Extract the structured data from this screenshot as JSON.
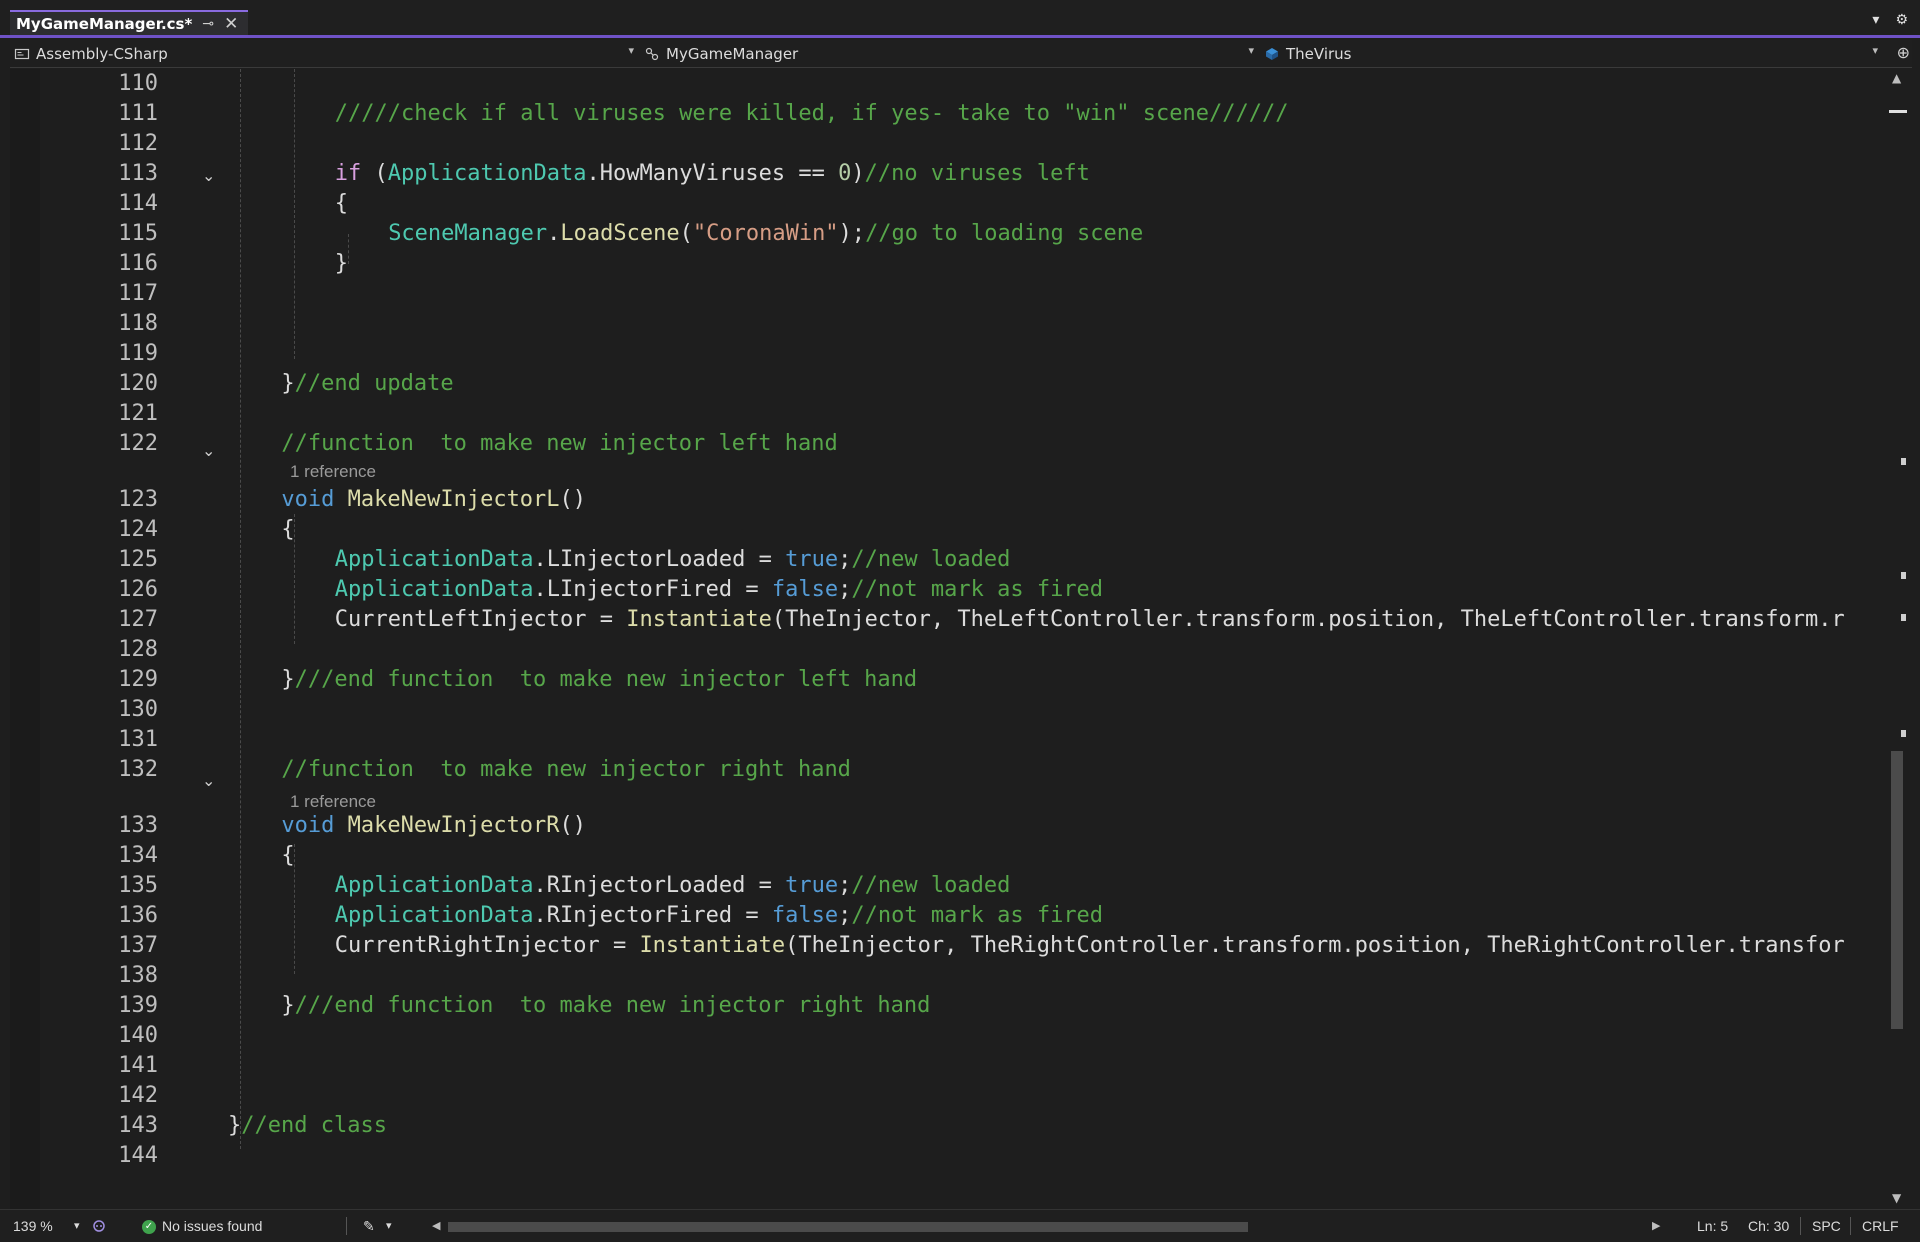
{
  "tab": {
    "title": "MyGameManager.cs*",
    "pin_icon": "pin-icon",
    "close_icon": "close-icon"
  },
  "tab_right": {
    "dropdown_icon": "chevron-down-icon",
    "settings_icon": "gear-icon"
  },
  "navbar": {
    "project": "Assembly-CSharp",
    "type": "MyGameManager",
    "member": "TheVirus"
  },
  "editor": {
    "line_numbers": [
      "110",
      "111",
      "112",
      "113",
      "114",
      "115",
      "116",
      "117",
      "118",
      "119",
      "120",
      "121",
      "122",
      "123",
      "124",
      "125",
      "126",
      "127",
      "128",
      "129",
      "130",
      "131",
      "132",
      "133",
      "134",
      "135",
      "136",
      "137",
      "138",
      "139",
      "140",
      "141",
      "142",
      "143",
      "144"
    ],
    "codelens": [
      "1 reference",
      "1 reference"
    ],
    "lines": [
      [],
      [
        [
          "cm",
          "/////check if all viruses were killed, if yes- take to \"win\" scene//////"
        ]
      ],
      [],
      [
        [
          "ctl",
          "if"
        ],
        [
          "txt",
          " ("
        ],
        [
          "cls",
          "ApplicationData"
        ],
        [
          "txt",
          ".HowManyViruses == "
        ],
        [
          "num",
          "0"
        ],
        [
          "txt",
          ")"
        ],
        [
          "cm",
          "//no viruses left"
        ]
      ],
      [
        [
          "txt",
          "{"
        ]
      ],
      [
        [
          "cls",
          "SceneManager"
        ],
        [
          "txt",
          "."
        ],
        [
          "mth",
          "LoadScene"
        ],
        [
          "txt",
          "("
        ],
        [
          "str",
          "\"CoronaWin\""
        ],
        [
          "txt",
          ");"
        ],
        [
          "cm",
          "//go to loading scene"
        ]
      ],
      [
        [
          "txt",
          "}"
        ]
      ],
      [],
      [],
      [],
      [
        [
          "txt",
          "}"
        ],
        [
          "cm",
          "//end update"
        ]
      ],
      [],
      [
        [
          "cm",
          "//function  to make new injector left hand"
        ]
      ],
      [
        [
          "kw",
          "void"
        ],
        [
          "txt",
          " "
        ],
        [
          "mth",
          "MakeNewInjectorL"
        ],
        [
          "txt",
          "()"
        ]
      ],
      [
        [
          "txt",
          "{"
        ]
      ],
      [
        [
          "cls",
          "ApplicationData"
        ],
        [
          "txt",
          ".LInjectorLoaded = "
        ],
        [
          "kw",
          "true"
        ],
        [
          "txt",
          ";"
        ],
        [
          "cm",
          "//new loaded"
        ]
      ],
      [
        [
          "cls",
          "ApplicationData"
        ],
        [
          "txt",
          ".LInjectorFired = "
        ],
        [
          "kw",
          "false"
        ],
        [
          "txt",
          ";"
        ],
        [
          "cm",
          "//not mark as fired"
        ]
      ],
      [
        [
          "txt",
          "CurrentLeftInjector = "
        ],
        [
          "mth",
          "Instantiate"
        ],
        [
          "txt",
          "(TheInjector, TheLeftController.transform.position, TheLeftController.transform.r"
        ]
      ],
      [],
      [
        [
          "txt",
          "}"
        ],
        [
          "cm",
          "///end function  to make new injector left hand"
        ]
      ],
      [],
      [],
      [
        [
          "cm",
          "//function  to make new injector right hand"
        ]
      ],
      [
        [
          "kw",
          "void"
        ],
        [
          "txt",
          " "
        ],
        [
          "mth",
          "MakeNewInjectorR"
        ],
        [
          "txt",
          "()"
        ]
      ],
      [
        [
          "txt",
          "{"
        ]
      ],
      [
        [
          "cls",
          "ApplicationData"
        ],
        [
          "txt",
          ".RInjectorLoaded = "
        ],
        [
          "kw",
          "true"
        ],
        [
          "txt",
          ";"
        ],
        [
          "cm",
          "//new loaded"
        ]
      ],
      [
        [
          "cls",
          "ApplicationData"
        ],
        [
          "txt",
          ".RInjectorFired = "
        ],
        [
          "kw",
          "false"
        ],
        [
          "txt",
          ";"
        ],
        [
          "cm",
          "//not mark as fired"
        ]
      ],
      [
        [
          "txt",
          "CurrentRightInjector = "
        ],
        [
          "mth",
          "Instantiate"
        ],
        [
          "txt",
          "(TheInjector, TheRightController.transform.position, TheRightController.transfor"
        ]
      ],
      [],
      [
        [
          "txt",
          "}"
        ],
        [
          "cm",
          "///end function  to make new injector right hand"
        ]
      ],
      [],
      [],
      [],
      [
        [
          "txt",
          "}"
        ],
        [
          "cm",
          "//end class"
        ]
      ],
      []
    ]
  },
  "statusbar": {
    "zoom": "139 %",
    "issues": "No issues found",
    "line": "Ln: 5",
    "char": "Ch: 30",
    "whitespace": "SPC",
    "line_ending": "CRLF"
  },
  "colors": {
    "accent": "#6f52c6",
    "comment": "#57a64a",
    "keyword": "#569cd6",
    "control_keyword": "#d8a0df",
    "class": "#4ec9b0",
    "method": "#dcdcaa",
    "string": "#d69d85",
    "text": "#dcdcdc",
    "number": "#b5cea8",
    "background": "#1e1e1e"
  }
}
